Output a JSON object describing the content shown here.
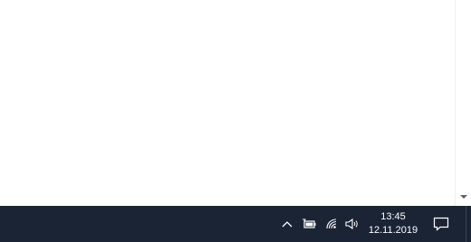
{
  "taskbar": {
    "clock": {
      "time": "13:45",
      "date": "12.11.2019"
    },
    "icons": {
      "show_hidden": "chevron-up-icon",
      "battery": "battery-icon",
      "network": "wifi-icon",
      "volume": "volume-icon",
      "notifications": "notification-icon"
    }
  },
  "colors": {
    "taskbar_bg": "#1b2434",
    "desktop_bg": "#ffffff",
    "icon_fg": "#ffffff"
  }
}
